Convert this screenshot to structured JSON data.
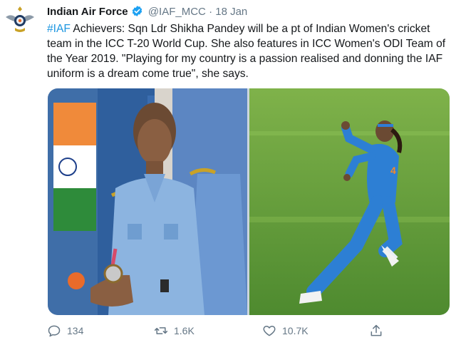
{
  "tweet": {
    "author_name": "Indian Air Force",
    "handle": "@IAF_MCC",
    "separator": "·",
    "date": "18 Jan",
    "hashtag": "#IAF",
    "text_rest": " Achievers: Sqn Ldr Shikha Pandey will be a pt of Indian Women's cricket team in the ICC T-20 World Cup. She also features in ICC Women's ODI Team of the Year 2019. \"Playing for my country is a passion realised and donning the IAF uniform is a dream come true\", she says."
  },
  "actions": {
    "replies": "134",
    "retweets": "1.6K",
    "likes": "10.7K"
  },
  "icons": {
    "avatar": "iaf-emblem-icon",
    "verified": "verified-badge-icon",
    "reply": "reply-icon",
    "retweet": "retweet-icon",
    "like": "heart-icon",
    "share": "share-icon"
  },
  "colors": {
    "link": "#1b95e0",
    "verified": "#1da1f2",
    "muted": "#657786",
    "text": "#14171a"
  }
}
